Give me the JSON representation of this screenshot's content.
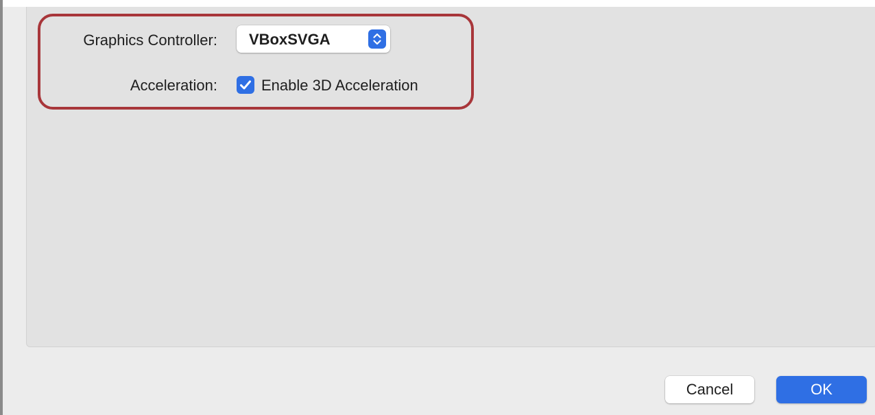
{
  "display_settings": {
    "graphics_controller_label": "Graphics Controller:",
    "graphics_controller_value": "VBoxSVGA",
    "acceleration_label": "Acceleration:",
    "enable_3d_label": "Enable 3D Acceleration",
    "enable_3d_checked": true
  },
  "footer": {
    "cancel_label": "Cancel",
    "ok_label": "OK"
  },
  "icons": {
    "stepper": "chevron-up-down-icon",
    "checkmark": "checkmark-icon"
  },
  "colors": {
    "accent": "#2f6fe4",
    "highlight_annotation": "#a8363a",
    "panel_background": "#e2e2e2",
    "window_background": "#ececec"
  }
}
